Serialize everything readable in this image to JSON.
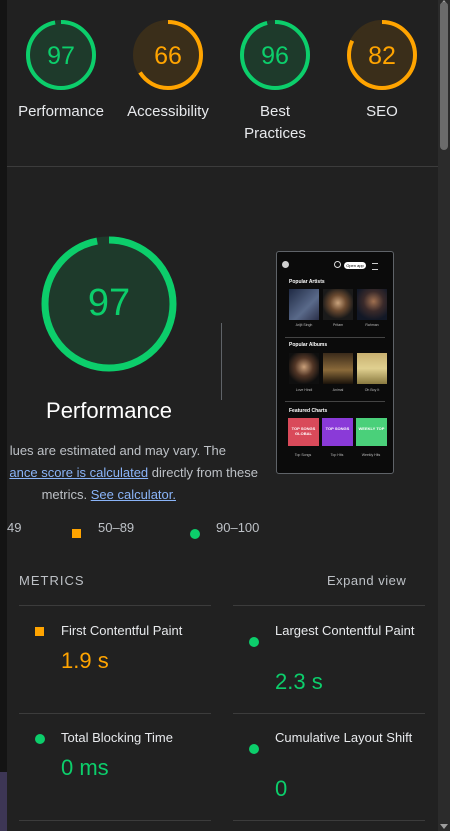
{
  "gauges": [
    {
      "score": "97",
      "label_line1": "Performance",
      "label_line2": "",
      "color": "#0cce6b",
      "fill": 0.97
    },
    {
      "score": "66",
      "label_line1": "Accessibility",
      "label_line2": "",
      "color": "#ffa400",
      "fill": 0.66
    },
    {
      "score": "96",
      "label_line1": "Best",
      "label_line2": "Practices",
      "color": "#0cce6b",
      "fill": 0.96
    },
    {
      "score": "82",
      "label_line1": "SEO",
      "label_line2": "",
      "color": "#ffa400",
      "fill": 0.82
    }
  ],
  "performance": {
    "score": "97",
    "title": "Performance",
    "desc_line1": "lues are estimated and may vary. The",
    "desc_link1": "ance score is calculated",
    "desc_line2_rest": " directly from these",
    "desc_line3": "metrics. ",
    "desc_link2": "See calculator."
  },
  "screenshot": {
    "open_app": "Open app",
    "popular_artists": "Popular Artists",
    "artists": [
      "Arijit Singh",
      "Pritam",
      "Rahman"
    ],
    "popular_albums": "Popular Albums",
    "albums": [
      "Love Hindi",
      "Animal",
      "Oh Boy It"
    ],
    "featured_charts": "Featured Charts",
    "charts": [
      "TOP SONGS GLOBAL",
      "TOP SONGS",
      "WEEKLY TOP"
    ],
    "chart_captions": [
      "Top Songs",
      "Top Hits",
      "Weekly Hits"
    ]
  },
  "legend": {
    "fail": "49",
    "average": "50–89",
    "pass": "90–100"
  },
  "metrics": {
    "heading": "METRICS",
    "expand": "Expand view",
    "items": [
      {
        "name": "First Contentful Paint",
        "value": "1.9 s",
        "color": "#ffa400"
      },
      {
        "name": "Largest Contentful Paint",
        "value": "2.3 s",
        "color": "#0cce6b"
      },
      {
        "name": "Total Blocking Time",
        "value": "0 ms",
        "color": "#0cce6b"
      },
      {
        "name": "Cumulative Layout Shift",
        "value": "0",
        "color": "#0cce6b"
      }
    ]
  },
  "colors": {
    "pass": "#0cce6b",
    "average": "#ffa400",
    "link": "#8ab4f8"
  }
}
